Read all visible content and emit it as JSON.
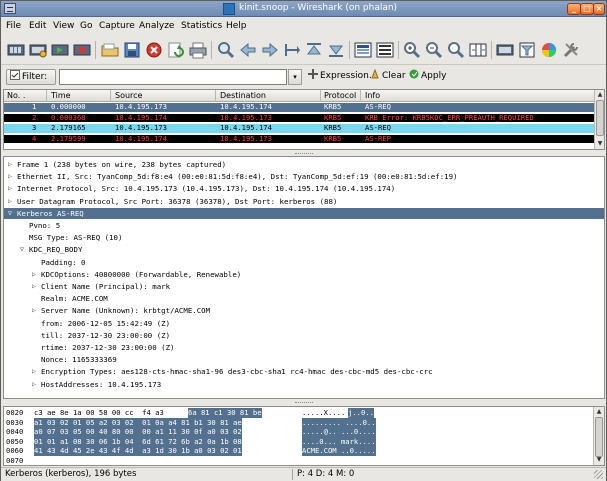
{
  "window": {
    "title": "kinit.snoop - Wireshark (on phalan)"
  },
  "menu": [
    "File",
    "Edit",
    "View",
    "Go",
    "Capture",
    "Analyze",
    "Statistics",
    "Help"
  ],
  "toolbar": {
    "icons": [
      "interface-list-icon",
      "capture-options-icon",
      "start-capture-icon",
      "stop-capture-icon",
      "restart-capture-icon",
      "open-file-icon",
      "save-file-icon",
      "close-file-icon",
      "reload-icon",
      "print-icon",
      "find-icon",
      "back-icon",
      "forward-icon",
      "go-to-packet-icon",
      "first-packet-icon",
      "last-packet-icon",
      "colorize-icon",
      "auto-scroll-icon",
      "zoom-in-icon",
      "zoom-out-icon",
      "zoom-normal-icon",
      "resize-columns-icon",
      "capture-filters-icon",
      "display-filters-icon",
      "coloring-rules-icon",
      "preferences-icon"
    ]
  },
  "filter": {
    "label": "Filter:",
    "value": "",
    "expression_label": "Expression...",
    "clear_label": "Clear",
    "apply_label": "Apply"
  },
  "packet_list": {
    "columns": [
      "No. .",
      "Time",
      "Source",
      "Destination",
      "Protocol",
      "Info"
    ],
    "rows": [
      {
        "no": "1",
        "time": "0.000000",
        "source": "10.4.195.173",
        "destination": "10.4.195.174",
        "protocol": "KRB5",
        "info": "AS-REQ",
        "bg": "#53708f",
        "fg": "#ffffff"
      },
      {
        "no": "2",
        "time": "0.000368",
        "source": "10.4.195.174",
        "destination": "10.4.195.173",
        "protocol": "KRB5",
        "info": "KRB Error: KRB5KDC_ERR_PREAUTH_REQUIRED",
        "bg": "#000000",
        "fg": "#ff4040"
      },
      {
        "no": "3",
        "time": "2.179165",
        "source": "10.4.195.173",
        "destination": "10.4.195.174",
        "protocol": "KRB5",
        "info": "AS-REQ",
        "bg": "#7ad8ee",
        "fg": "#000000"
      },
      {
        "no": "4",
        "time": "2.179599",
        "source": "10.4.195.174",
        "destination": "10.4.195.173",
        "protocol": "KRB5",
        "info": "AS-REP",
        "bg": "#000000",
        "fg": "#ff4040"
      }
    ]
  },
  "details": [
    {
      "twist": "▷",
      "text": "Frame 1 (238 bytes on wire, 238 bytes captured)"
    },
    {
      "twist": "▷",
      "text": "Ethernet II, Src: TyanComp_5d:f8:e4 (00:e0:81:5d:f8:e4), Dst: TyanComp_5d:ef:19 (00:e0:81:5d:ef:19)"
    },
    {
      "twist": "▷",
      "text": "Internet Protocol, Src: 10.4.195.173 (10.4.195.173), Dst: 10.4.195.174 (10.4.195.174)"
    },
    {
      "twist": "▷",
      "text": "User Datagram Protocol, Src Port: 36378 (36378), Dst Port: kerberos (88)"
    },
    {
      "twist": "▽",
      "text": "Kerberos AS-REQ"
    },
    {
      "twist": "",
      "text": "Pvno: 5"
    },
    {
      "twist": "",
      "text": "MSG Type: AS-REQ (10)"
    },
    {
      "twist": "▽",
      "text": "KDC_REQ_BODY"
    },
    {
      "twist": "",
      "text": "Padding: 0"
    },
    {
      "twist": "▷",
      "text": "KDCOptions: 40800000 (Forwardable, Renewable)"
    },
    {
      "twist": "▷",
      "text": "Client Name (Principal): mark"
    },
    {
      "twist": "",
      "text": "Realm: ACME.COM"
    },
    {
      "twist": "▷",
      "text": "Server Name (Unknown): krbtgt/ACME.COM"
    },
    {
      "twist": "",
      "text": "from: 2006-12-05 15:42:49 (Z)"
    },
    {
      "twist": "",
      "text": "till: 2037-12-30 23:00:00 (Z)"
    },
    {
      "twist": "",
      "text": "rtime: 2037-12-30 23:00:00 (Z)"
    },
    {
      "twist": "",
      "text": "Nonce: 1165333369"
    },
    {
      "twist": "▷",
      "text": "Encryption Types: aes128-cts-hmac-sha1-96 des3-cbc-sha1 rc4-hmac des-cbc-md5 des-cbc-crc"
    },
    {
      "twist": "▷",
      "text": "HostAddresses: 10.4.195.173"
    }
  ],
  "bytes": [
    {
      "offset": "0020",
      "hex_plain": "c3 ae 8e 1a 00 58 00 cc  f4 a3",
      "hex_hl": "6a 81 c1 30 81 be",
      "ascii_plain": ".....X....",
      "ascii_hl": "j..0.."
    },
    {
      "offset": "0030",
      "hex_plain": "",
      "hex_hl": "a1 03 02 01 05 a2 03 02  01 0a a4 81 b1 30 81 ae",
      "ascii_plain": "",
      "ascii_hl": "......... ....0.."
    },
    {
      "offset": "0040",
      "hex_plain": "",
      "hex_hl": "a0 07 03 05 00 40 80 00  00 a1 11 30 0f a0 03 02",
      "ascii_plain": "",
      "ascii_hl": ".....@.. ...0...."
    },
    {
      "offset": "0050",
      "hex_plain": "",
      "hex_hl": "01 01 a1 08 30 06 1b 04  6d 61 72 6b a2 0a 1b 08",
      "ascii_plain": "",
      "ascii_hl": "....0... mark...."
    },
    {
      "offset": "0060",
      "hex_plain": "",
      "hex_hl": "41 43 4d 45 2e 43 4f 4d  a3 1d 30 1b a0 03 02 01",
      "ascii_plain": "",
      "ascii_hl": "ACME.COM ..0....."
    },
    {
      "offset": "0070",
      "hex_plain": "",
      "hex_hl": "",
      "ascii_plain": "",
      "ascii_hl": ""
    }
  ],
  "status": {
    "left": "Kerberos (kerberos), 196 bytes",
    "right": "P: 4 D: 4 M: 0"
  }
}
